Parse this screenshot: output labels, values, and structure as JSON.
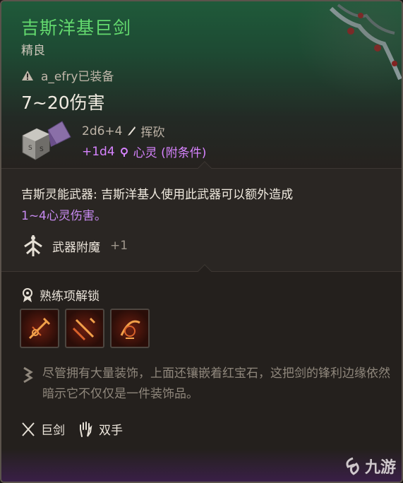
{
  "item": {
    "name": "吉斯洋基巨剑",
    "rarity": "精良",
    "equipped_by": "a_efry已装备",
    "damage_range": "7~20伤害",
    "base_damage": "2d6+4",
    "base_damage_type": "挥砍",
    "bonus_damage": "+1d4",
    "bonus_damage_type": "心灵 (附条件)"
  },
  "description": {
    "line1": "吉斯灵能武器: 吉斯洋基人使用此武器可以额外造成",
    "line2": "1~4心灵伤害。",
    "enchant_label": "武器附魔",
    "enchant_value": "+1"
  },
  "proficiency": {
    "label": "熟练项解锁",
    "actions": [
      "action-1",
      "action-2",
      "action-3"
    ]
  },
  "flavor": {
    "text": "尽管拥有大量装饰，上面还镶嵌着红宝石，这把剑的锋利边缘依然暗示它不仅仅是一件装饰品。"
  },
  "properties": {
    "type": "巨剑",
    "handedness": "双手"
  },
  "watermark": {
    "text": "九游"
  },
  "colors": {
    "title": "#63d96e",
    "psychic": "#c78af0",
    "header_bg": "#1f5a3a"
  }
}
